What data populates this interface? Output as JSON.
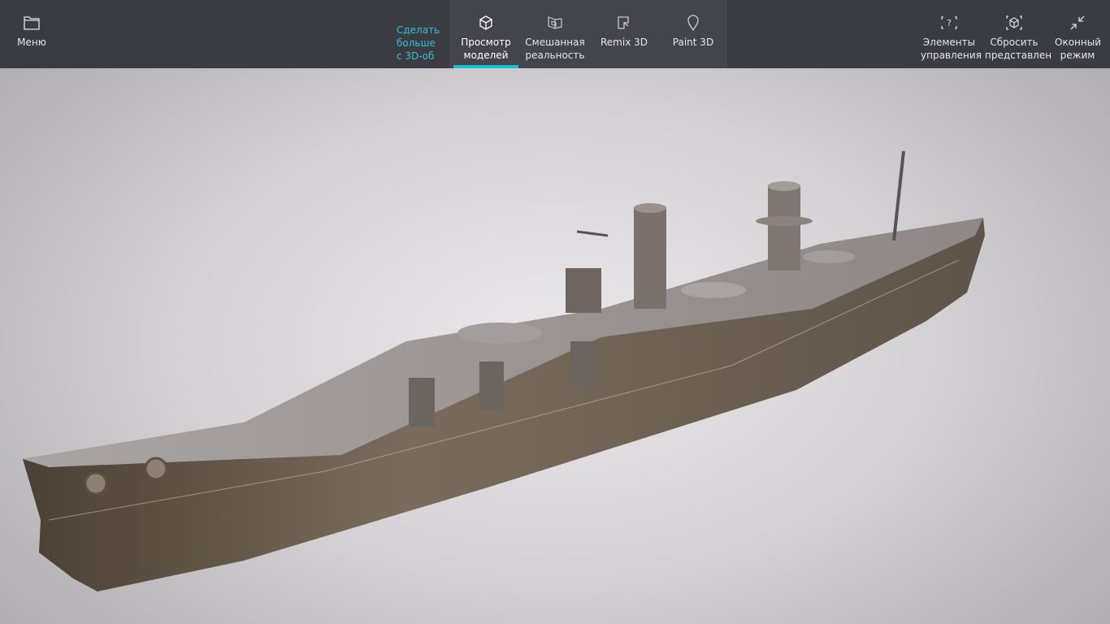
{
  "toolbar": {
    "menu": {
      "label": "Меню",
      "icon": "folder-icon"
    },
    "promo": {
      "label": "Сделать больше с 3D-об"
    },
    "tabs": [
      {
        "label": "Просмотр моделей",
        "icon": "cube-icon",
        "active": true
      },
      {
        "label": "Смешанная реальность",
        "icon": "mixed-reality-icon",
        "active": false
      },
      {
        "label": "Remix 3D",
        "icon": "remix-icon",
        "active": false
      },
      {
        "label": "Paint 3D",
        "icon": "paint-icon",
        "active": false
      }
    ],
    "right": [
      {
        "label": "Элементы управления",
        "icon": "controls-help-icon"
      },
      {
        "label": "Сбросить представлен",
        "icon": "reset-view-icon"
      },
      {
        "label": "Оконный режим",
        "icon": "window-mode-icon"
      }
    ]
  },
  "colors": {
    "accent": "#18c0cc",
    "toolbar": "#3a3b43"
  }
}
